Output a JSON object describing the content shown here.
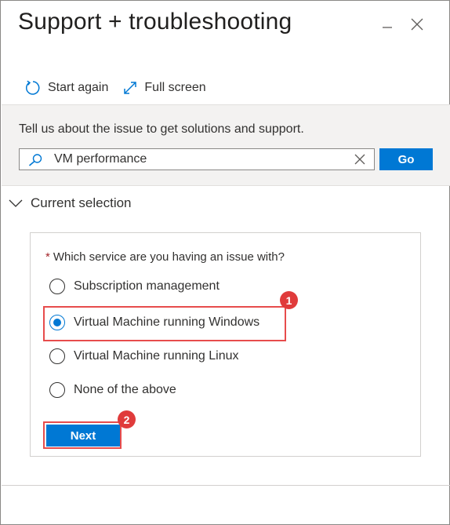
{
  "panel": {
    "title": "Support + troubleshooting"
  },
  "toolbar": {
    "start_again_label": "Start again",
    "start_again_icon": "refresh-icon",
    "full_screen_label": "Full screen",
    "full_screen_icon": "expand-icon"
  },
  "search": {
    "prompt": "Tell us about the issue to get solutions and support.",
    "value": "VM performance",
    "placeholder": "",
    "go_label": "Go"
  },
  "current_selection": {
    "heading": "Current selection",
    "expanded": true,
    "question_required_marker": "*",
    "question": "Which service are you having an issue with?",
    "options": [
      {
        "label": "Subscription management",
        "selected": false
      },
      {
        "label": "Virtual Machine running Windows",
        "selected": true
      },
      {
        "label": "Virtual Machine running Linux",
        "selected": false
      },
      {
        "label": "None of the above",
        "selected": false
      }
    ],
    "next_label": "Next"
  },
  "annotations": {
    "badge_1": "1",
    "badge_2": "2",
    "highlight_color": "#e74c4c"
  },
  "colors": {
    "accent": "#0078d4",
    "search_band": "#f3f2f1",
    "required": "#a4262c"
  }
}
